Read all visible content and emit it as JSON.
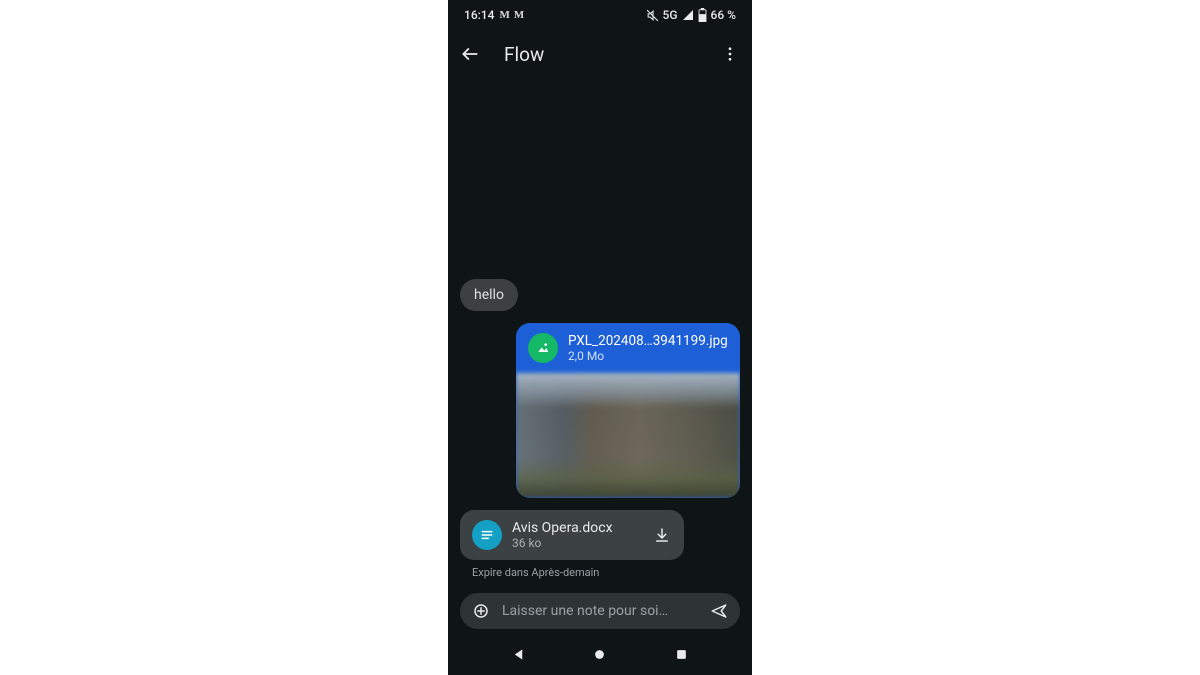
{
  "status": {
    "time": "16:14",
    "network": "5G",
    "battery": "66 %"
  },
  "header": {
    "title": "Flow"
  },
  "messages": {
    "m1": {
      "text": "hello"
    },
    "m2": {
      "filename": "PXL_202408…3941199.jpg",
      "size": "2,0 Mo"
    },
    "m3": {
      "filename": "Avis Opera.docx",
      "size": "36 ko"
    },
    "expire_label": "Expire dans Après-demain"
  },
  "composer": {
    "placeholder": "Laisser une note pour soi…"
  }
}
